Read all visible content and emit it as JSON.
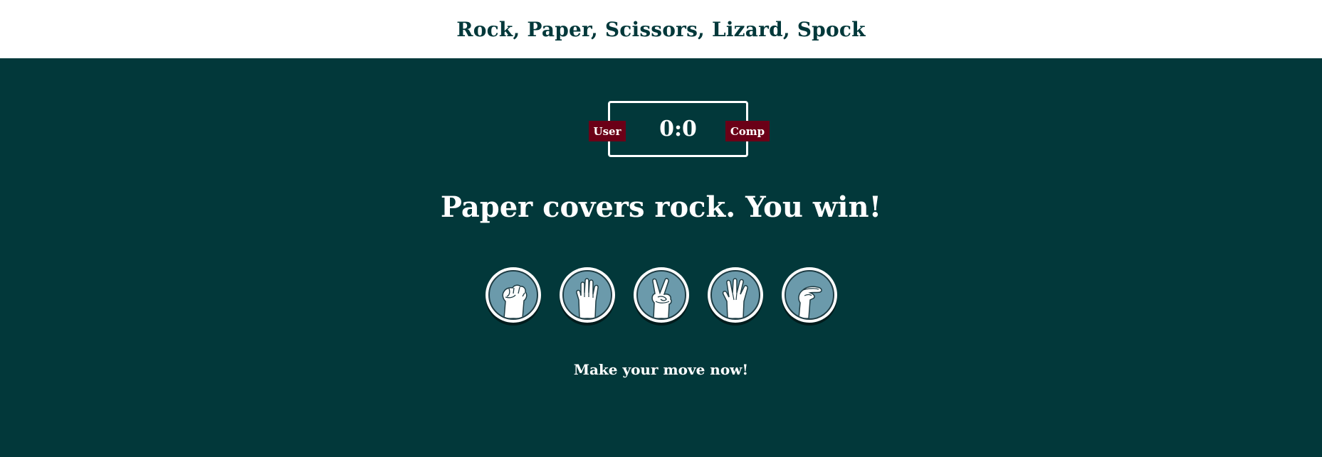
{
  "header": {
    "title": "Rock, Paper, Scissors, Lizard, Spock"
  },
  "scoreboard": {
    "user_label": "User",
    "comp_label": "Comp",
    "score": "0:0"
  },
  "result": {
    "message": "Paper covers rock. You win!"
  },
  "choices": [
    {
      "name": "rock",
      "icon": "rock-hand-icon"
    },
    {
      "name": "paper",
      "icon": "paper-hand-icon"
    },
    {
      "name": "scissors",
      "icon": "scissors-hand-icon"
    },
    {
      "name": "lizard",
      "icon": "lizard-hand-icon"
    },
    {
      "name": "spock",
      "icon": "spock-hand-icon"
    }
  ],
  "prompt": {
    "text": "Make your move now!"
  },
  "colors": {
    "background": "#02383a",
    "header_bg": "#ffffff",
    "badge": "#6b0017",
    "choice_fill": "#6b9aab"
  }
}
